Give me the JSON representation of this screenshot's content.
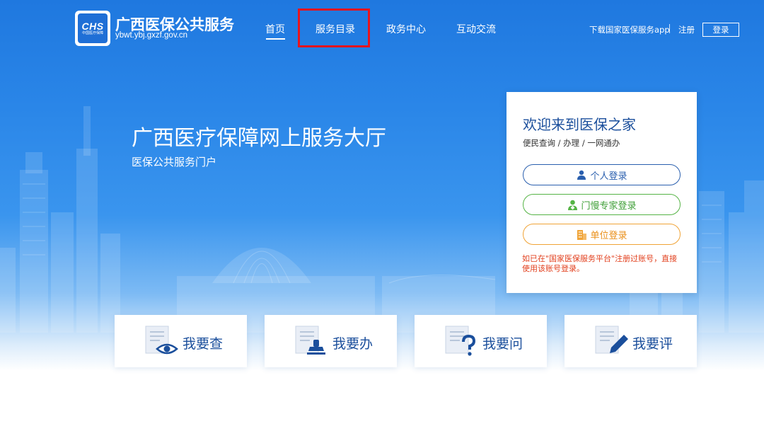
{
  "header": {
    "logo_text": "CHS",
    "logo_subtext": "中国医疗保障",
    "site_name": "广西医保公共服务",
    "site_domain": "ybwt.ybj.gxzf.gov.cn",
    "nav": {
      "home": "首页",
      "catalog": "服务目录",
      "gov_center": "政务中心",
      "interaction": "互动交流"
    },
    "download_app": "下载国家医保服务app",
    "register": "注册",
    "login": "登录"
  },
  "hero": {
    "title": "广西医疗保障网上服务大厅",
    "subtitle": "医保公共服务门户"
  },
  "login_card": {
    "title": "欢迎来到医保之家",
    "subtitle": "便民查询 / 办理 / 一网通办",
    "personal_login": "个人登录",
    "expert_login": "门慢专家登录",
    "unit_login": "单位登录",
    "note": "如已在\"国家医保服务平台\"注册过账号，直接使用该账号登录。",
    "colors": {
      "personal": "#2a5fae",
      "expert": "#55b345",
      "unit": "#f0a336",
      "note": "#e2411f"
    }
  },
  "tiles": {
    "query": "我要查",
    "handle": "我要办",
    "ask": "我要问",
    "rate": "我要评"
  },
  "icons": {
    "personal": "person-icon",
    "expert": "doctor-icon",
    "unit": "building-icon",
    "query": "eye-document-icon",
    "handle": "stamp-document-icon",
    "ask": "question-document-icon",
    "rate": "pen-document-icon"
  },
  "colors": {
    "accent": "#1f78df",
    "title_blue": "#1b4f9c",
    "highlight": "#e8141d"
  }
}
